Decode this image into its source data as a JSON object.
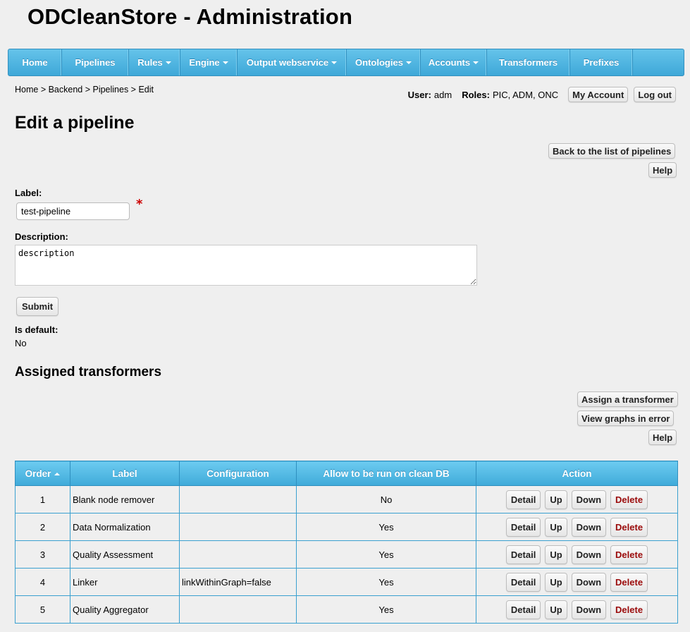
{
  "app": {
    "title": "ODCleanStore - Administration"
  },
  "nav": {
    "items": [
      {
        "label": "Home",
        "dropdown": false
      },
      {
        "label": "Pipelines",
        "dropdown": false
      },
      {
        "label": "Rules",
        "dropdown": true
      },
      {
        "label": "Engine",
        "dropdown": true
      },
      {
        "label": "Output webservice",
        "dropdown": true
      },
      {
        "label": "Ontologies",
        "dropdown": true
      },
      {
        "label": "Accounts",
        "dropdown": true
      },
      {
        "label": "Transformers",
        "dropdown": false
      },
      {
        "label": "Prefixes",
        "dropdown": false
      }
    ]
  },
  "breadcrumb": "Home > Backend > Pipelines > Edit",
  "user": {
    "user_label": "User:",
    "user_value": "adm",
    "roles_label": "Roles:",
    "roles_value": "PIC, ADM, ONC",
    "my_account": "My Account",
    "logout": "Log out"
  },
  "page": {
    "title": "Edit a pipeline",
    "back_button": "Back to the list of pipelines",
    "help_button": "Help"
  },
  "form": {
    "label_caption": "Label:",
    "label_value": "test-pipeline",
    "required_mark": "*",
    "description_caption": "Description:",
    "description_value": "description",
    "submit": "Submit",
    "default_caption": "Is default:",
    "default_value": "No"
  },
  "transformers": {
    "title": "Assigned transformers",
    "assign_button": "Assign a transformer",
    "errors_button": "View graphs in error",
    "help_button": "Help",
    "columns": [
      "Order",
      "Label",
      "Configuration",
      "Allow to be run on clean DB",
      "Action"
    ],
    "rows": [
      {
        "order": "1",
        "label": "Blank node remover",
        "config": "",
        "clean_db": "No"
      },
      {
        "order": "2",
        "label": "Data Normalization",
        "config": "",
        "clean_db": "Yes"
      },
      {
        "order": "3",
        "label": "Quality Assessment",
        "config": "",
        "clean_db": "Yes"
      },
      {
        "order": "4",
        "label": "Linker",
        "config": "linkWithinGraph=false",
        "clean_db": "Yes"
      },
      {
        "order": "5",
        "label": "Quality Aggregator",
        "config": "",
        "clean_db": "Yes"
      }
    ],
    "actions": {
      "detail": "Detail",
      "up": "Up",
      "down": "Down",
      "delete": "Delete"
    }
  }
}
